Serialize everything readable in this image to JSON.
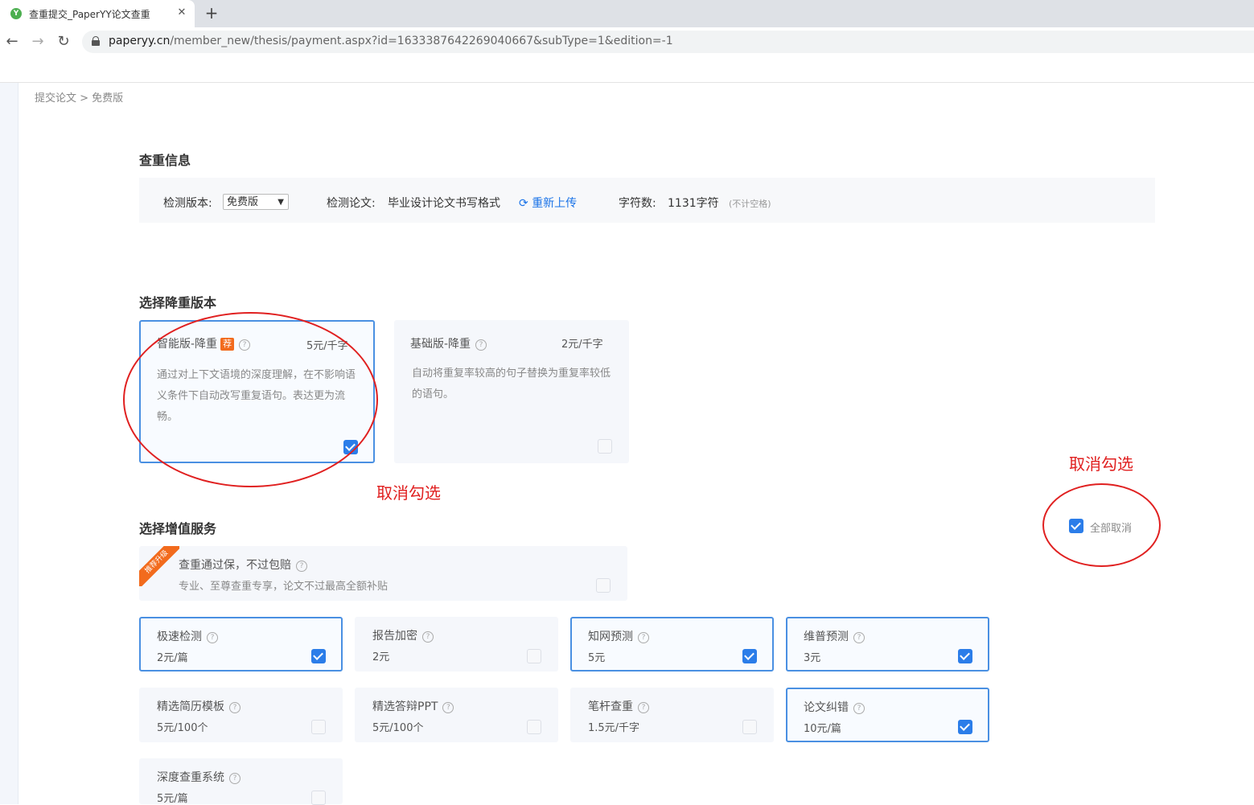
{
  "browser": {
    "tab_title": "查重提交_PaperYY论文查重",
    "favicon_letter": "Y",
    "close_glyph": "✕",
    "new_tab_glyph": "+",
    "url_domain": "paperyy.cn",
    "url_path": "/member_new/thesis/payment.aspx?id=1633387642269040667&subType=1&edition=-1"
  },
  "breadcrumb": "提交论文 > 免费版",
  "info": {
    "section_title": "查重信息",
    "version_label": "检测版本:",
    "version_value": "免费版",
    "paper_label": "检测论文:",
    "paper_value": "毕业设计论文书写格式",
    "reupload": "重新上传",
    "chars_label": "字符数:",
    "chars_value": "1131字符",
    "chars_note": "(不计空格)"
  },
  "reduce": {
    "section_title": "选择降重版本",
    "options": [
      {
        "name": "智能版-降重",
        "badge": "荐",
        "price": "5元/千字",
        "desc": "通过对上下文语境的深度理解，在不影响语义条件下自动改写重复语句。表达更为流畅。",
        "checked": true
      },
      {
        "name": "基础版-降重",
        "price": "2元/千字",
        "desc": "自动将重复率较高的句子替换为重复率较低的语句。",
        "checked": false
      }
    ]
  },
  "services": {
    "section_title": "选择增值服务",
    "select_all_label": "全部取消",
    "promo": {
      "ribbon": "推荐升级",
      "title": "查重通过保，不过包赔",
      "desc": "专业、至尊查重专享，论文不过最高全额补贴",
      "checked": false
    },
    "items": [
      {
        "name": "极速检测",
        "price": "2元/篇",
        "checked": true
      },
      {
        "name": "报告加密",
        "price": "2元",
        "checked": false
      },
      {
        "name": "知网预测",
        "price": "5元",
        "checked": true
      },
      {
        "name": "维普预测",
        "price": "3元",
        "checked": true
      },
      {
        "name": "精选简历模板",
        "price": "5元/100个",
        "checked": false
      },
      {
        "name": "精选答辩PPT",
        "price": "5元/100个",
        "checked": false
      },
      {
        "name": "笔杆查重",
        "price": "1.5元/千字",
        "checked": false
      },
      {
        "name": "论文纠错",
        "price": "10元/篇",
        "checked": true
      },
      {
        "name": "深度查重系统",
        "price": "5元/篇",
        "checked": false
      }
    ]
  },
  "annotations": {
    "uncheck_1": "取消勾选",
    "uncheck_2": "取消勾选",
    "color": "#e02020"
  }
}
